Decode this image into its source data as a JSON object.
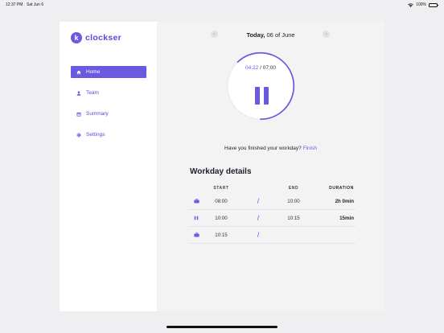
{
  "status": {
    "time": "12:37 PM",
    "date": "Sat Jun 6",
    "battery": "100%"
  },
  "brand": {
    "mark": "k",
    "name": "clockser"
  },
  "nav": [
    {
      "label": "Home",
      "icon": "home-icon",
      "active": true
    },
    {
      "label": "Team",
      "icon": "person-icon",
      "active": false
    },
    {
      "label": "Summary",
      "icon": "calendar-icon",
      "active": false
    },
    {
      "label": "Settings",
      "icon": "gear-icon",
      "active": false
    }
  ],
  "day": {
    "prefix": "Today,",
    "date": "06 of June",
    "prev_icon": "chevron-left-icon",
    "next_icon": "chevron-right-icon"
  },
  "timer": {
    "elapsed": "04:22",
    "separator": " / ",
    "total": "07:00",
    "progress": 0.62,
    "accent": "#6a5ae0"
  },
  "finish": {
    "question": "Have you finished your workday?",
    "link": "Finish"
  },
  "details": {
    "title": "Workday details",
    "columns": {
      "start": "START",
      "end": "END",
      "duration": "DURATION"
    },
    "rows": [
      {
        "icon": "briefcase-icon",
        "start": "08:00",
        "sep": "/",
        "end": "10:00",
        "duration": "2h 0min"
      },
      {
        "icon": "pause-icon",
        "start": "10:00",
        "sep": "/",
        "end": "10:15",
        "duration": "15min"
      },
      {
        "icon": "briefcase-icon",
        "start": "10:15",
        "sep": "/",
        "end": "",
        "duration": ""
      }
    ]
  }
}
